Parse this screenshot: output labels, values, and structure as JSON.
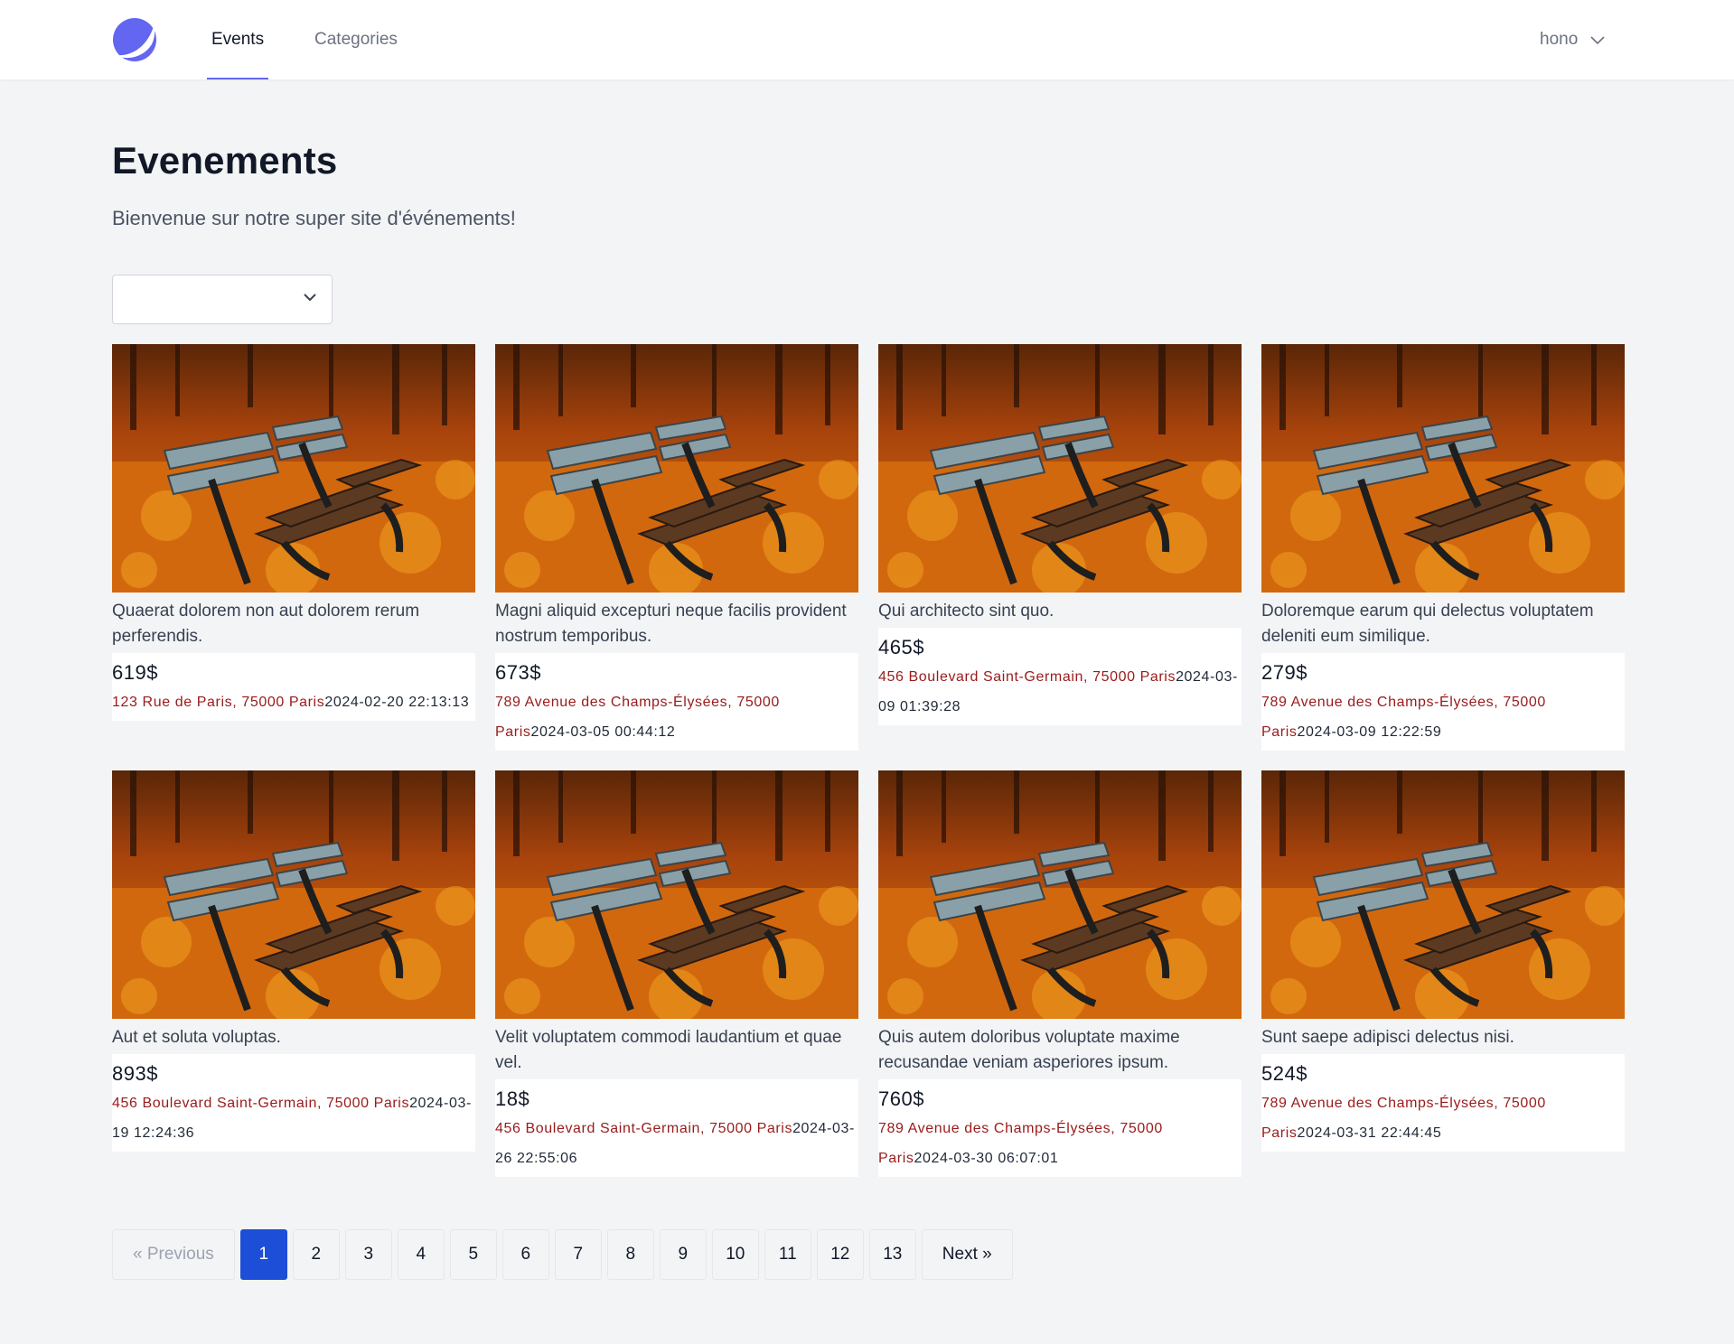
{
  "nav": {
    "tabs": [
      {
        "label": "Events",
        "active": true
      },
      {
        "label": "Categories",
        "active": false
      }
    ],
    "user": {
      "name": "hono"
    }
  },
  "header": {
    "title": "Evenements",
    "subtitle": "Bienvenue sur notre super site d'événements!"
  },
  "filter": {
    "selected": ""
  },
  "events": [
    {
      "title": "Quaerat dolorem non aut dolorem rerum perferendis.",
      "price": "619$",
      "address": "123 Rue de Paris, 75000 Paris",
      "datetime": "2024-02-20 22:13:13"
    },
    {
      "title": "Magni aliquid excepturi neque facilis provident nostrum temporibus.",
      "price": "673$",
      "address": "789 Avenue des Champs-Élysées, 75000 Paris",
      "datetime": "2024-03-05 00:44:12"
    },
    {
      "title": "Qui architecto sint quo.",
      "price": "465$",
      "address": "456 Boulevard Saint-Germain, 75000 Paris",
      "datetime": "2024-03-09 01:39:28"
    },
    {
      "title": "Doloremque earum qui delectus voluptatem deleniti eum similique.",
      "price": "279$",
      "address": "789 Avenue des Champs-Élysées, 75000 Paris",
      "datetime": "2024-03-09 12:22:59"
    },
    {
      "title": "Aut et soluta voluptas.",
      "price": "893$",
      "address": "456 Boulevard Saint-Germain, 75000 Paris",
      "datetime": "2024-03-19 12:24:36"
    },
    {
      "title": "Velit voluptatem commodi laudantium et quae vel.",
      "price": "18$",
      "address": "456 Boulevard Saint-Germain, 75000 Paris",
      "datetime": "2024-03-26 22:55:06"
    },
    {
      "title": "Quis autem doloribus voluptate maxime recusandae veniam asperiores ipsum.",
      "price": "760$",
      "address": "789 Avenue des Champs-Élysées, 75000 Paris",
      "datetime": "2024-03-30 06:07:01"
    },
    {
      "title": "Sunt saepe adipisci delectus nisi.",
      "price": "524$",
      "address": "789 Avenue des Champs-Élysées, 75000 Paris",
      "datetime": "2024-03-31 22:44:45"
    }
  ],
  "pagination": {
    "previous": "« Previous",
    "next": "Next »",
    "pages": [
      "1",
      "2",
      "3",
      "4",
      "5",
      "6",
      "7",
      "8",
      "9",
      "10",
      "11",
      "12",
      "13"
    ],
    "current": "1"
  },
  "colors": {
    "accent": "#6366f1",
    "address": "#991b1b",
    "page_active": "#1d4ed8"
  }
}
